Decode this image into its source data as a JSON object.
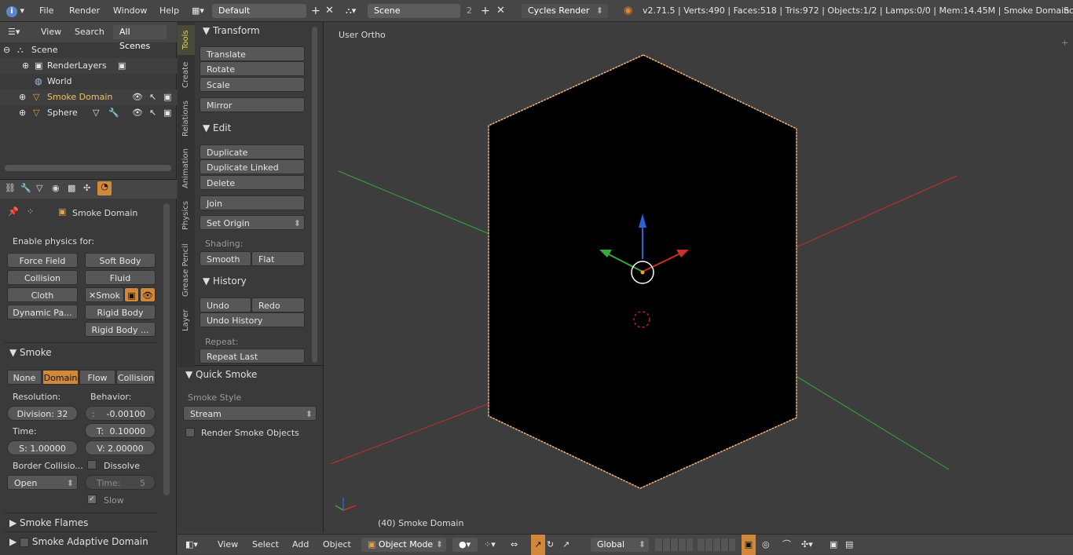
{
  "menu": {
    "file": "File",
    "render": "Render",
    "window": "Window",
    "help": "Help"
  },
  "screen": {
    "layout": "Default",
    "scene": "Scene",
    "scene_users": "2",
    "engine": "Cycles Render"
  },
  "stats": "v2.71.5 | Verts:490 | Faces:518 | Tris:972 | Objects:1/2 | Lamps:0/0 | Mem:14.45M | Smoke Domain",
  "stats_tail": "Sc",
  "outliner": {
    "view": "View",
    "search": "Search",
    "filter": "All Scenes",
    "rows": [
      "Scene",
      "RenderLayers",
      "World",
      "Smoke Domain",
      "Sphere"
    ]
  },
  "properties": {
    "object_name": "Smoke Domain",
    "enable_physics": "Enable physics for:",
    "physics_buttons": {
      "force_field": "Force Field",
      "soft_body": "Soft Body",
      "collision": "Collision",
      "fluid": "Fluid",
      "cloth": "Cloth",
      "smoke": "Smok",
      "dynamic_paint": "Dynamic Pa...",
      "rigid_body": "Rigid Body",
      "rigid_body_constraint": "Rigid Body ..."
    },
    "smoke_panel": "Smoke",
    "smoke_types": [
      "None",
      "Domain",
      "Flow",
      "Collision"
    ],
    "resolution_label": "Resolution:",
    "behavior_label": "Behavior:",
    "division": "Division: 32",
    "alpha": "-0.00100",
    "time_label": "Time:",
    "beta": "0.10000",
    "beta_prefix": "T:",
    "speed": "S: 1.00000",
    "vorticity": "V: 2.00000",
    "border_label": "Border Collisio...",
    "dissolve": "Dissolve",
    "border_value": "Open",
    "dissolve_time": "Time:",
    "dissolve_time_val": "5",
    "slow": "Slow",
    "flames_panel": "Smoke Flames",
    "adaptive_panel": "Smoke Adaptive Domain"
  },
  "tool_tabs": [
    "Tools",
    "Create",
    "Relations",
    "Animation",
    "Physics",
    "Grease Pencil",
    "Layer"
  ],
  "tools": {
    "transform": "Transform",
    "translate": "Translate",
    "rotate": "Rotate",
    "scale": "Scale",
    "mirror": "Mirror",
    "edit": "Edit",
    "duplicate": "Duplicate",
    "duplicate_linked": "Duplicate Linked",
    "delete": "Delete",
    "join": "Join",
    "set_origin": "Set Origin",
    "shading": "Shading:",
    "smooth": "Smooth",
    "flat": "Flat",
    "history": "History",
    "undo": "Undo",
    "redo": "Redo",
    "undo_history": "Undo History",
    "repeat": "Repeat:",
    "repeat_last": "Repeat Last"
  },
  "operator": {
    "title": "Quick Smoke",
    "style_label": "Smoke Style",
    "style_value": "Stream",
    "render_objects": "Render Smoke Objects"
  },
  "viewport": {
    "view_name": "User Ortho",
    "frame_info": "(40) Smoke Domain"
  },
  "header3d": {
    "view": "View",
    "select": "Select",
    "add": "Add",
    "object": "Object",
    "mode": "Object Mode",
    "orientation": "Global"
  },
  "colors": {
    "selected_outline": "#f0b37a",
    "x_axis": "#c8302d",
    "y_axis": "#36a93b",
    "z_axis": "#2a62d8",
    "accent": "#d1883a"
  }
}
